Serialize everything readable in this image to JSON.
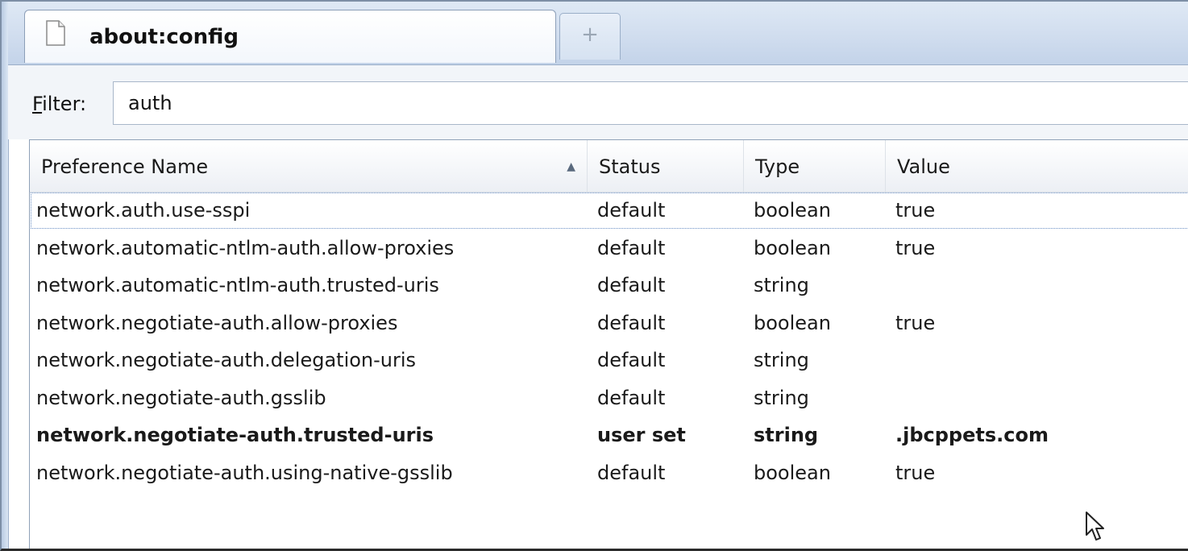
{
  "tab": {
    "title": "about:config",
    "new_tab_label": "+"
  },
  "filter": {
    "label_accesskey": "F",
    "label_rest": "ilter:",
    "value": "auth"
  },
  "columns": {
    "name": "Preference Name",
    "status": "Status",
    "type": "Type",
    "value": "Value",
    "sort_indicator": "ascending"
  },
  "rows": [
    {
      "name": "network.auth.use-sspi",
      "status": "default",
      "type": "boolean",
      "value": "true"
    },
    {
      "name": "network.automatic-ntlm-auth.allow-proxies",
      "status": "default",
      "type": "boolean",
      "value": "true"
    },
    {
      "name": "network.automatic-ntlm-auth.trusted-uris",
      "status": "default",
      "type": "string",
      "value": ""
    },
    {
      "name": "network.negotiate-auth.allow-proxies",
      "status": "default",
      "type": "boolean",
      "value": "true"
    },
    {
      "name": "network.negotiate-auth.delegation-uris",
      "status": "default",
      "type": "string",
      "value": ""
    },
    {
      "name": "network.negotiate-auth.gsslib",
      "status": "default",
      "type": "string",
      "value": ""
    },
    {
      "name": "network.negotiate-auth.trusted-uris",
      "status": "user set",
      "type": "string",
      "value": ".jbcppets.com"
    },
    {
      "name": "network.negotiate-auth.using-native-gsslib",
      "status": "default",
      "type": "boolean",
      "value": "true"
    }
  ],
  "icons": {
    "page": "page-icon",
    "sort": "sort-ascending-icon",
    "cursor": "mouse-pointer-icon"
  },
  "colors": {
    "tabstrip": "#cfdcee",
    "border": "#8fa1b8",
    "focus_outline": "#6a8fc4"
  }
}
